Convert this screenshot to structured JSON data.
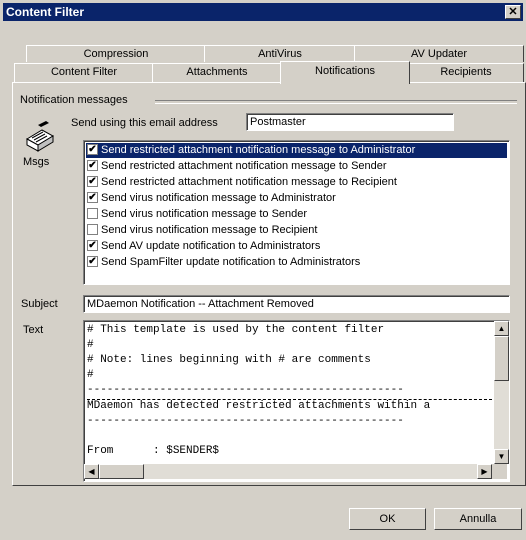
{
  "window": {
    "title": "Content Filter",
    "close_glyph": "✕"
  },
  "tabs": {
    "row1": [
      "Compression",
      "AntiVirus",
      "AV Updater"
    ],
    "row2": [
      "Content Filter",
      "Attachments",
      "Notifications",
      "Recipients"
    ],
    "active": "Notifications"
  },
  "notifications": {
    "group_label": "Notification messages",
    "send_using_label": "Send using this email address",
    "send_using_value": "Postmaster",
    "msgs_label": "Msgs",
    "items": [
      {
        "label": "Send restricted attachment notification message to Administrator",
        "checked": true,
        "selected": true
      },
      {
        "label": "Send restricted attachment notification message to Sender",
        "checked": true,
        "selected": false
      },
      {
        "label": "Send restricted attachment notification message to Recipient",
        "checked": true,
        "selected": false
      },
      {
        "label": "Send virus notification message to Administrator",
        "checked": true,
        "selected": false
      },
      {
        "label": "Send virus notification message to Sender",
        "checked": false,
        "selected": false
      },
      {
        "label": "Send virus notification message to Recipient",
        "checked": false,
        "selected": false
      },
      {
        "label": "Send AV update notification to Administrators",
        "checked": true,
        "selected": false
      },
      {
        "label": "Send SpamFilter update notification to Administrators",
        "checked": true,
        "selected": false
      }
    ],
    "subject_label": "Subject",
    "subject_value": "MDaemon Notification -- Attachment Removed",
    "text_label": "Text",
    "text_lines": [
      "# This template is used by the content filter",
      "#",
      "# Note: lines beginning with # are comments",
      "#",
      "------------------------------------------------",
      "MDaemon has detected restricted attachments within a",
      "------------------------------------------------",
      "",
      "From      : $SENDER$"
    ]
  },
  "buttons": {
    "ok": "OK",
    "cancel": "Annulla"
  },
  "icons": {
    "notification": "envelope-icon",
    "scroll_up": "scroll-up-arrow-icon",
    "scroll_down": "scroll-down-arrow-icon",
    "scroll_left": "scroll-left-arrow-icon",
    "scroll_right": "scroll-right-arrow-icon"
  }
}
